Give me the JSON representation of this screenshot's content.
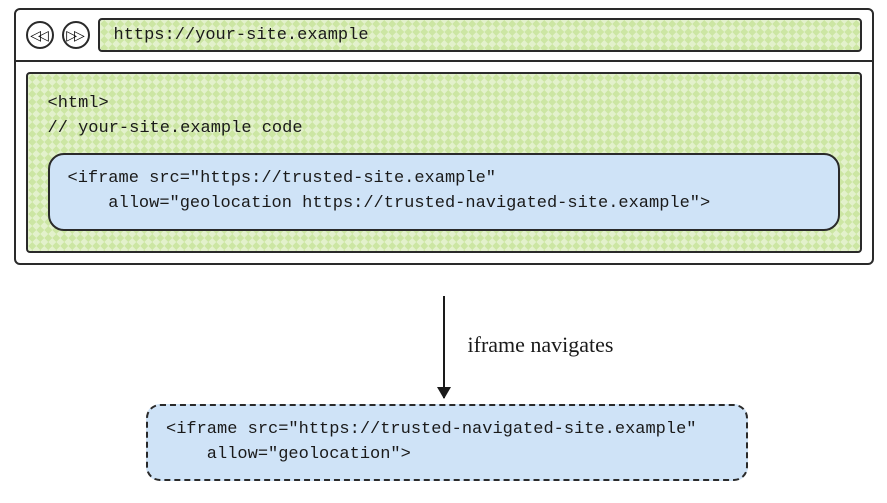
{
  "toolbar": {
    "back_glyph": "◁◁",
    "forward_glyph": "▷▷",
    "url": "https://your-site.example"
  },
  "page": {
    "code_line_1": "<html>",
    "code_line_2": "// your-site.example code",
    "iframe_line_1": "<iframe src=\"https://trusted-site.example\"",
    "iframe_line_2": "    allow=\"geolocation https://trusted-navigated-site.example\">"
  },
  "arrow": {
    "label": "iframe navigates"
  },
  "navigated": {
    "iframe_line_1": "<iframe src=\"https://trusted-navigated-site.example\"",
    "iframe_line_2": "    allow=\"geolocation\">"
  }
}
